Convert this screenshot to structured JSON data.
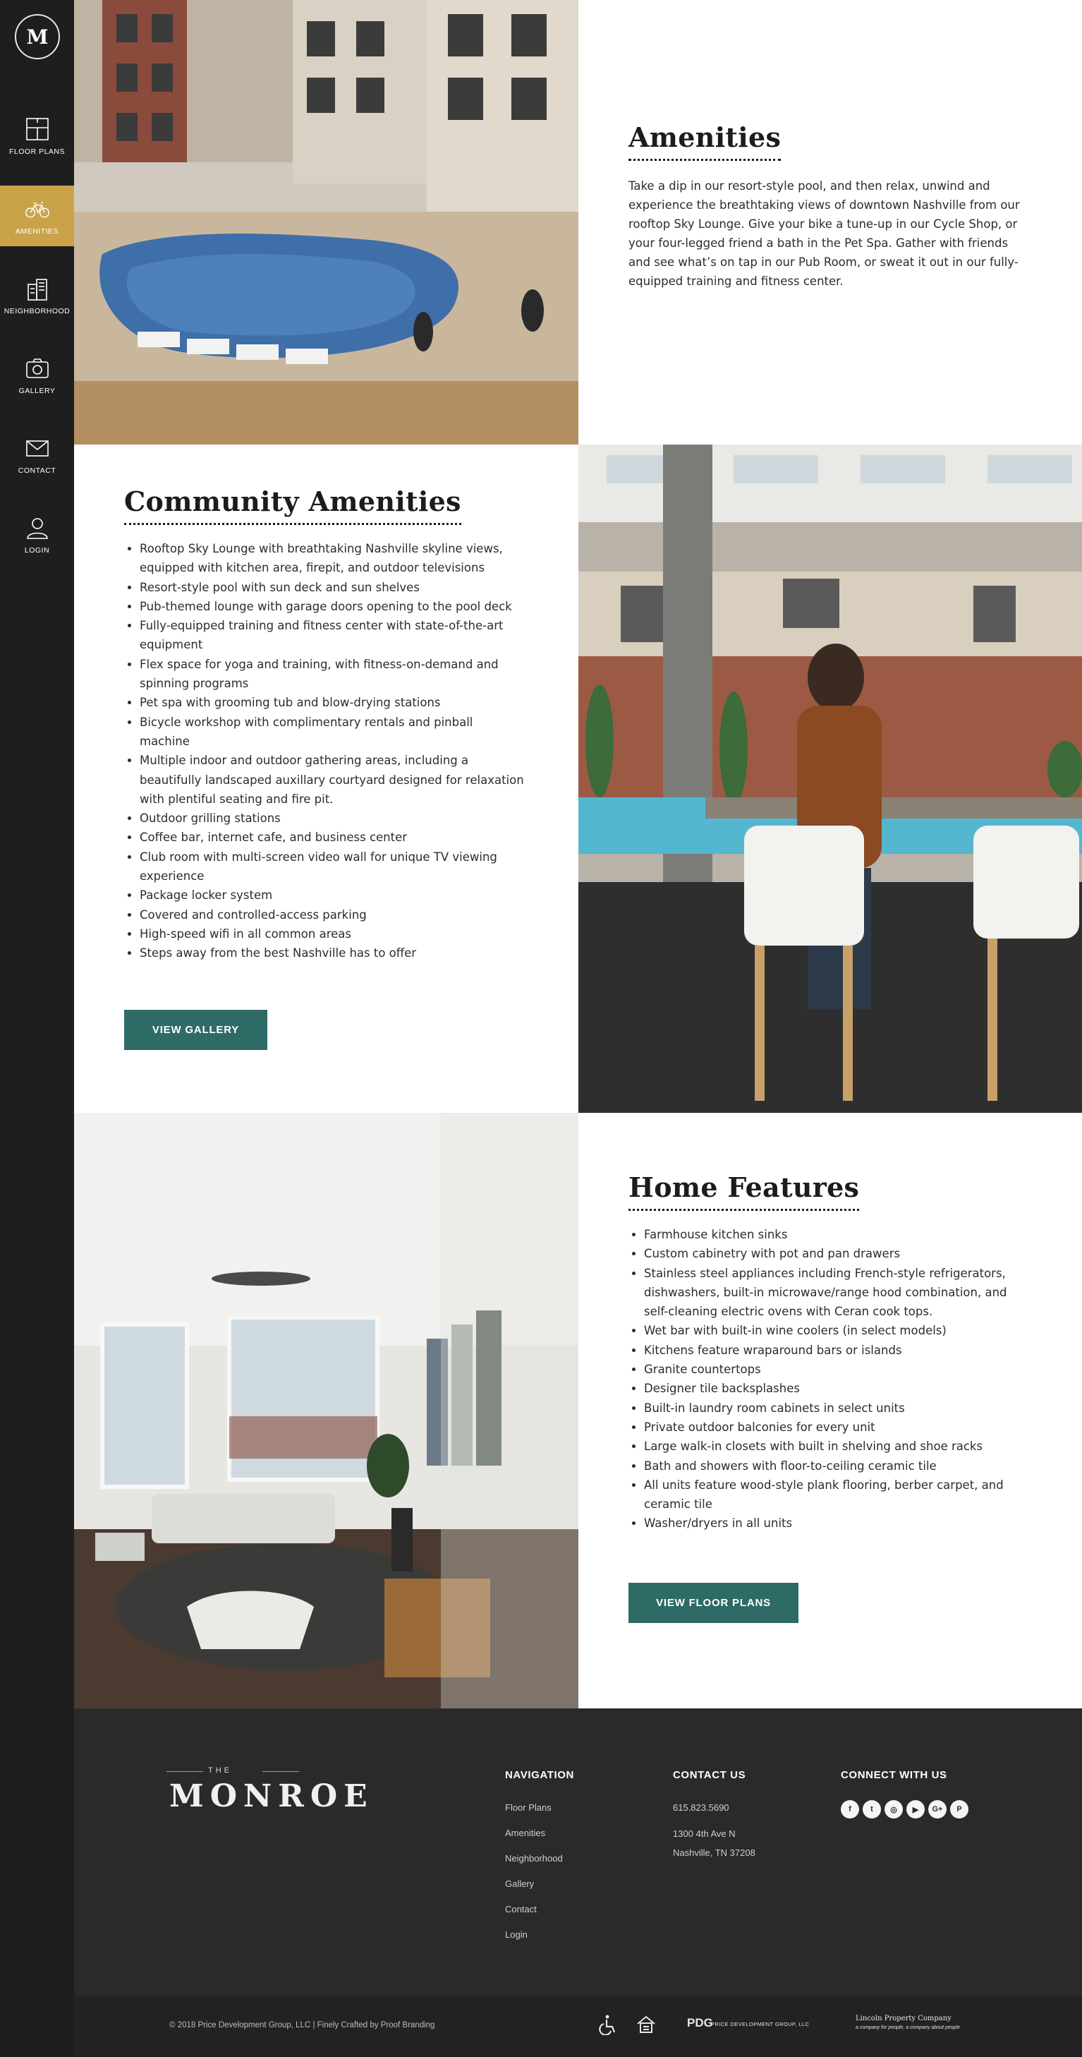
{
  "sidebar": {
    "logo_letter": "M",
    "items": [
      {
        "label": "FLOOR PLANS",
        "icon": "floorplan-icon",
        "active": false
      },
      {
        "label": "AMENITIES",
        "icon": "bicycle-icon",
        "active": true
      },
      {
        "label": "NEIGHBORHOOD",
        "icon": "buildings-icon",
        "active": false
      },
      {
        "label": "GALLERY",
        "icon": "camera-icon",
        "active": false
      },
      {
        "label": "CONTACT",
        "icon": "envelope-icon",
        "active": false
      },
      {
        "label": "LOGIN",
        "icon": "user-icon",
        "active": false
      }
    ]
  },
  "amenities": {
    "title": "Amenities",
    "text": "Take a dip in our resort-style pool, and then relax, unwind and experience the breathtaking views of downtown Nashville from our rooftop Sky Lounge. Give your bike a tune-up in our Cycle Shop, or your four-legged friend a bath in the Pet Spa. Gather with friends and see what’s on tap in our Pub Room, or sweat it out in our fully-equipped training and fitness center."
  },
  "community": {
    "title": "Community Amenities",
    "items": [
      "Rooftop Sky Lounge with breathtaking Nashville skyline views, equipped with kitchen area, firepit, and outdoor televisions",
      "Resort-style pool with sun deck and sun shelves",
      "Pub-themed lounge with garage doors opening to the pool deck",
      "Fully-equipped training and fitness center with state-of-the-art equipment",
      "Flex space for yoga and training, with fitness-on-demand and spinning programs",
      "Pet spa with grooming tub and blow-drying stations",
      "Bicycle workshop with complimentary rentals and pinball machine",
      "Multiple indoor and outdoor gathering areas, including a beautifully landscaped auxillary courtyard designed for relaxation with plentiful seating and fire pit.",
      "Outdoor grilling stations",
      "Coffee bar, internet cafe, and business center",
      "Club room with multi-screen video wall for unique TV viewing experience",
      "Package locker system",
      "Covered and controlled-access parking",
      "High-speed wifi in all common areas",
      "Steps away from the best Nashville has to offer"
    ],
    "button": "VIEW GALLERY"
  },
  "home": {
    "title": "Home Features",
    "items": [
      "Farmhouse kitchen sinks",
      "Custom cabinetry with pot and pan drawers",
      "Stainless steel appliances including French-style refrigerators, dishwashers, built-in microwave/range hood combination, and self-cleaning electric ovens with Ceran cook tops.",
      "Wet bar with built-in wine coolers (in select models)",
      "Kitchens feature wraparound bars or islands",
      "Granite countertops",
      "Designer tile backsplashes",
      "Built-in laundry room cabinets in select units",
      "Private outdoor balconies for every unit",
      "Large walk-in closets with built in shelving and shoe racks",
      "Bath and showers with floor-to-ceiling ceramic tile",
      "All units feature wood-style plank flooring, berber carpet, and ceramic tile",
      "Washer/dryers in all units"
    ],
    "button": "VIEW FLOOR PLANS"
  },
  "footer": {
    "brand_the": "THE",
    "brand_name": "MONROE",
    "navigation": {
      "title": "NAVIGATION",
      "links": [
        "Floor Plans",
        "Amenities",
        "Neighborhood",
        "Gallery",
        "Contact",
        "Login"
      ]
    },
    "contact": {
      "title": "CONTACT US",
      "phone": "615.823.5690",
      "address1": "1300 4th Ave N",
      "address2": "Nashville, TN 37208"
    },
    "connect": {
      "title": "CONNECT WITH US",
      "icons": [
        {
          "name": "facebook-icon",
          "glyph": "f"
        },
        {
          "name": "twitter-icon",
          "glyph": "t"
        },
        {
          "name": "instagram-icon",
          "glyph": "◎"
        },
        {
          "name": "youtube-icon",
          "glyph": "▶"
        },
        {
          "name": "google-plus-icon",
          "glyph": "G+"
        },
        {
          "name": "pinterest-icon",
          "glyph": "P"
        }
      ]
    },
    "copyright": "© 2018 Price Development Group, LLC | Finely Crafted by Proof Branding",
    "partners": {
      "pdg_mark": "PDG",
      "pdg_text": "PRICE DEVELOPMENT GROUP, LLC",
      "lincoln_title": "Lincoln Property Company",
      "lincoln_tagline": "a company for people, a company about people"
    }
  },
  "colors": {
    "sidebar": "#1f1e1e",
    "accent_gold": "#c9a24a",
    "button_teal": "#2e6b66",
    "footer": "#2b2a2a"
  }
}
